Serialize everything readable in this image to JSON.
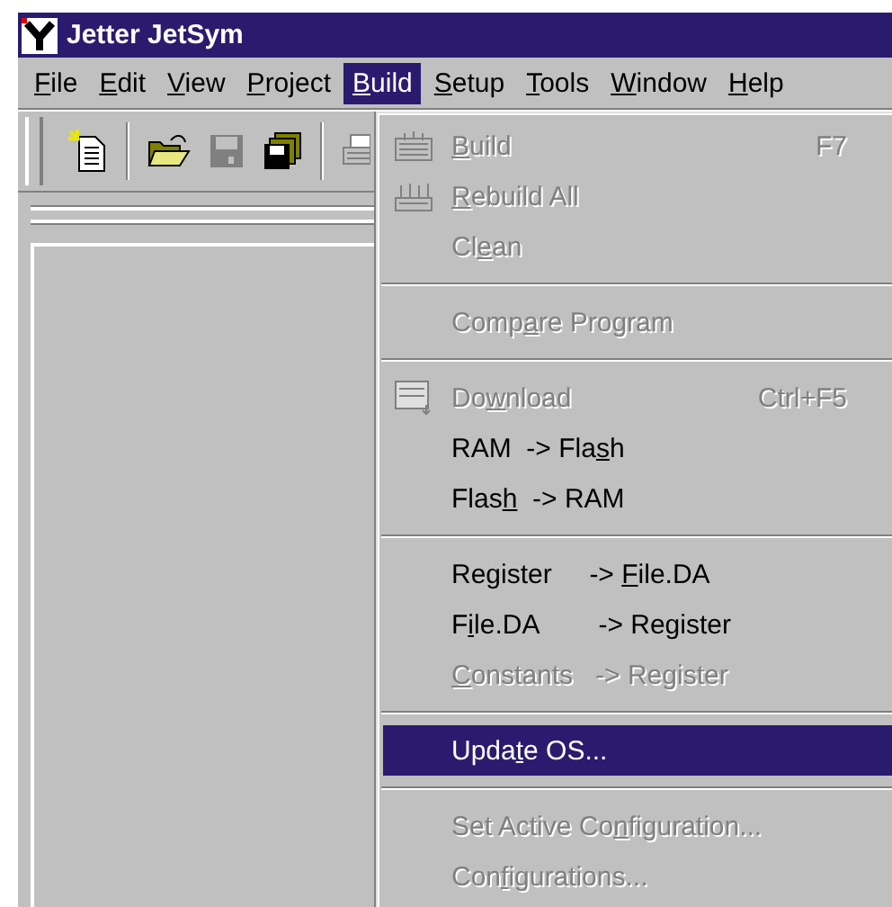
{
  "window": {
    "title": "Jetter JetSym"
  },
  "menubar": [
    {
      "key": "F",
      "after": "ile",
      "selected": false
    },
    {
      "key": "E",
      "after": "dit",
      "selected": false
    },
    {
      "key": "V",
      "after": "iew",
      "selected": false
    },
    {
      "key": "P",
      "after": "roject",
      "selected": false
    },
    {
      "key": "B",
      "after": "uild",
      "selected": true
    },
    {
      "key": "S",
      "after": "etup",
      "selected": false
    },
    {
      "key": "T",
      "after": "ools",
      "selected": false
    },
    {
      "key": "W",
      "after": "indow",
      "selected": false
    },
    {
      "key": "H",
      "after": "elp",
      "selected": false
    }
  ],
  "toolbar": [
    {
      "kind": "new"
    },
    {
      "kind": "sep"
    },
    {
      "kind": "open"
    },
    {
      "kind": "save",
      "disabled": true
    },
    {
      "kind": "saveall"
    },
    {
      "kind": "sep"
    },
    {
      "kind": "print"
    }
  ],
  "menu": [
    {
      "kind": "item",
      "key": "B",
      "after": "uild",
      "shortcut": "F7",
      "disabled": true,
      "selected": false
    },
    {
      "kind": "item",
      "key": "R",
      "after": "ebuild All",
      "disabled": true,
      "selected": false
    },
    {
      "kind": "item",
      "before": "Cl",
      "key": "e",
      "after": "an",
      "disabled": true,
      "selected": false
    },
    {
      "kind": "separator"
    },
    {
      "kind": "item",
      "before": "Comp",
      "key": "a",
      "after": "re Program",
      "disabled": true,
      "selected": false
    },
    {
      "kind": "separator"
    },
    {
      "kind": "item",
      "before": "Do",
      "key": "w",
      "after": "nload",
      "shortcut": "Ctrl+F5",
      "disabled": true,
      "selected": false
    },
    {
      "kind": "item",
      "before": "RAM  -> Fla",
      "key": "s",
      "after": "h",
      "disabled": false,
      "selected": false
    },
    {
      "kind": "item",
      "before": "Flas",
      "key": "h",
      "after": "  -> RAM",
      "disabled": false,
      "selected": false
    },
    {
      "kind": "separator"
    },
    {
      "kind": "item",
      "before": "Register     -> ",
      "key": "F",
      "after": "ile.DA",
      "disabled": false,
      "selected": false
    },
    {
      "kind": "item",
      "before": "F",
      "key": "i",
      "after": "le.DA        -> Register",
      "disabled": false,
      "selected": false
    },
    {
      "kind": "item",
      "key": "C",
      "after": "onstants   -> Register",
      "disabled": true,
      "selected": false
    },
    {
      "kind": "separator"
    },
    {
      "kind": "item",
      "before": "Upda",
      "key": "t",
      "after": "e OS...",
      "disabled": false,
      "selected": true
    },
    {
      "kind": "separator"
    },
    {
      "kind": "item",
      "before": "Set Active Co",
      "key": "n",
      "after": "figuration...",
      "disabled": true,
      "selected": false
    },
    {
      "kind": "item",
      "before": "Con",
      "key": "f",
      "after": "igurations...",
      "disabled": true,
      "selected": false
    }
  ]
}
